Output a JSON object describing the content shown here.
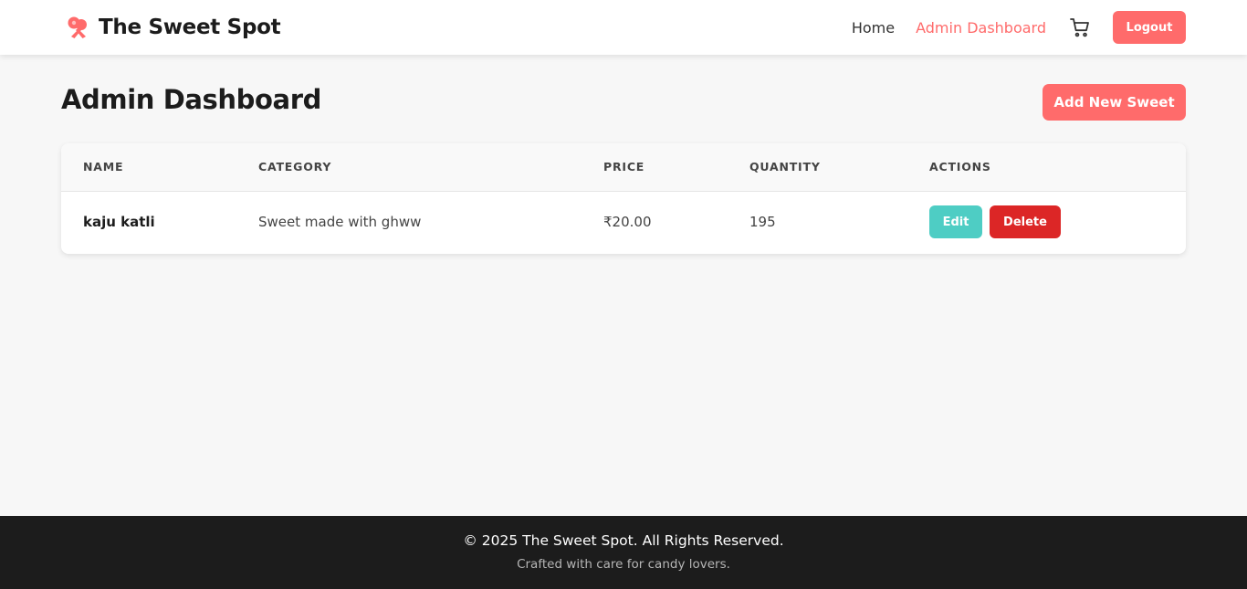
{
  "header": {
    "brand_name": "The Sweet Spot",
    "brand_icon": "candy-icon",
    "nav": {
      "home_label": "Home",
      "admin_label": "Admin Dashboard",
      "cart_icon": "cart-icon",
      "logout_label": "Logout"
    }
  },
  "main": {
    "title": "Admin Dashboard",
    "add_button_label": "Add New Sweet",
    "table": {
      "columns": [
        "Name",
        "Category",
        "Price",
        "Quantity",
        "Actions"
      ],
      "rows": [
        {
          "name": "kaju katli",
          "category": "Sweet made with ghww",
          "price": "₹20.00",
          "quantity": "195",
          "edit_label": "Edit",
          "delete_label": "Delete"
        }
      ]
    }
  },
  "footer": {
    "copyright": "© 2025 The Sweet Spot. All Rights Reserved.",
    "tagline": "Crafted with care for candy lovers."
  },
  "colors": {
    "accent": "#ff6b6b",
    "edit": "#4ecdc4",
    "delete": "#dc2626",
    "footer_bg": "#1c1c1c",
    "page_bg": "#f7f7f7"
  }
}
